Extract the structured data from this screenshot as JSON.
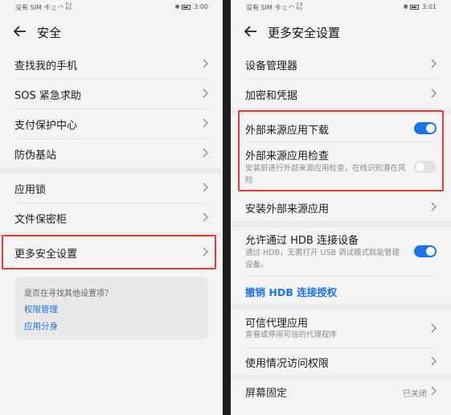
{
  "left": {
    "status": {
      "carrier": "没有 SIM 卡",
      "speed_value": "0.1",
      "speed_unit": "K/s",
      "time": "3:00"
    },
    "title": "安全",
    "items": [
      {
        "label": "查找我的手机"
      },
      {
        "label": "SOS 紧急求助"
      },
      {
        "label": "支付保护中心"
      },
      {
        "label": "防伪基站"
      },
      {
        "label": "应用锁"
      },
      {
        "label": "文件保密柜"
      },
      {
        "label": "更多安全设置"
      }
    ],
    "search_card": {
      "question": "是否在寻找其他设置项？",
      "links": [
        "权限管理",
        "应用分身"
      ]
    }
  },
  "right": {
    "status": {
      "carrier": "没有 SIM 卡",
      "speed_value": "2.9",
      "speed_unit": "K/s",
      "time": "3:01"
    },
    "title": "更多安全设置",
    "items": {
      "device_admin": "设备管理器",
      "encryption": "加密和凭据",
      "external_download": "外部来源应用下载",
      "external_check": "外部来源应用检查",
      "external_check_desc": "安装前进行外部来源应用检查，在线识别潜在风险",
      "install_external": "安装外部来源应用",
      "hdb": "允许通过 HDB 连接设备",
      "hdb_desc": "通过 HDB，无需打开 USB 调试模式就能管理设备。",
      "revoke_hdb": "撤销 HDB 连接授权",
      "trusted_agent": "可信代理应用",
      "trusted_agent_desc": "查看或停用可信的代理程序",
      "usage_access": "使用情况访问权限",
      "screen_pin": "屏幕固定",
      "screen_pin_value": "已关闭"
    },
    "toggles": {
      "external_download": true,
      "external_check": false,
      "hdb": true
    }
  },
  "colors": {
    "accent": "#1a73e8",
    "highlight": "#e53935"
  }
}
